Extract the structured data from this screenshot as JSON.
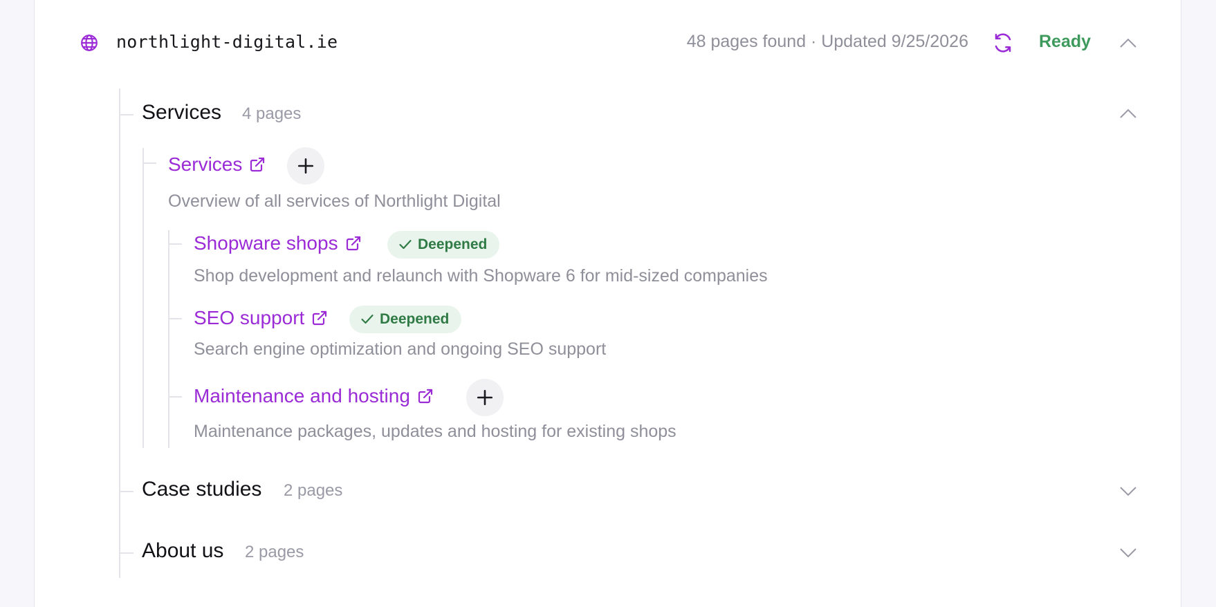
{
  "site": {
    "domain": "northlight-digital.ie",
    "meta": "48 pages found · Updated 9/25/2026",
    "status": "Ready",
    "status_color": "#3e9a5c",
    "accent_color": "#9b2bd6",
    "icons": {
      "site": "globe-icon",
      "refresh": "refresh-icon",
      "collapse": "chevron-up-icon"
    }
  },
  "groups": [
    {
      "title": "Services",
      "count": "4 pages",
      "expanded": true,
      "root_page": {
        "title": "Services",
        "description": "Overview of all services of Northlight Digital",
        "action": "add"
      },
      "children": [
        {
          "title": "Shopware shops",
          "badge": "Deepened",
          "description": "Shop development and relaunch with Shopware 6 for mid-sized companies"
        },
        {
          "title": "SEO support",
          "badge": "Deepened",
          "description": "Search engine optimization and ongoing SEO support"
        },
        {
          "title": "Maintenance and hosting",
          "action": "add",
          "description": "Maintenance packages, updates and hosting for existing shops"
        }
      ]
    },
    {
      "title": "Case studies",
      "count": "2 pages",
      "expanded": false
    },
    {
      "title": "About us",
      "count": "2 pages",
      "expanded": false
    }
  ]
}
